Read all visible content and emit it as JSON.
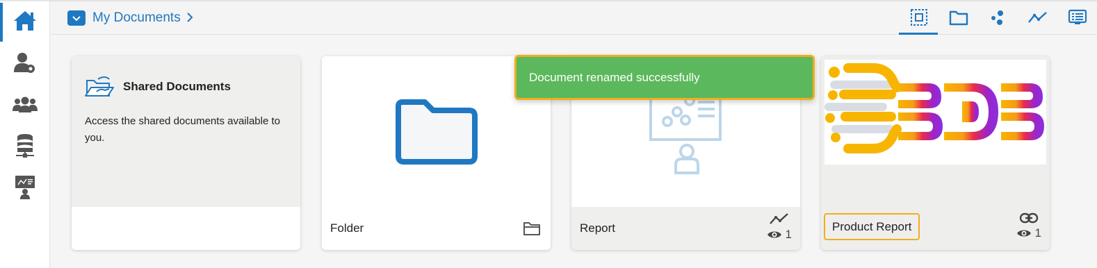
{
  "breadcrumb": {
    "title": "My Documents"
  },
  "sidebar": {
    "items": [
      {
        "icon": "home-icon",
        "active": true
      },
      {
        "icon": "user-settings-icon"
      },
      {
        "icon": "users-group-icon"
      },
      {
        "icon": "database-icon"
      },
      {
        "icon": "presentation-icon"
      }
    ]
  },
  "view_tools": [
    {
      "icon": "all-items-icon",
      "active": true
    },
    {
      "icon": "folder-icon"
    },
    {
      "icon": "dashboard-icon"
    },
    {
      "icon": "report-icon"
    },
    {
      "icon": "story-icon"
    }
  ],
  "cards": {
    "shared": {
      "title": "Shared Documents",
      "description": "Access the shared documents available to you."
    },
    "folder": {
      "name": "Folder"
    },
    "report": {
      "name": "Report",
      "views": "1"
    },
    "product": {
      "name": "Product Report",
      "views": "1"
    }
  },
  "toast": {
    "message": "Document renamed successfully"
  },
  "colors": {
    "accent": "#1f78c1",
    "success": "#5cb85c",
    "highlight": "#f0ad1e",
    "icon_gray": "#555555"
  }
}
